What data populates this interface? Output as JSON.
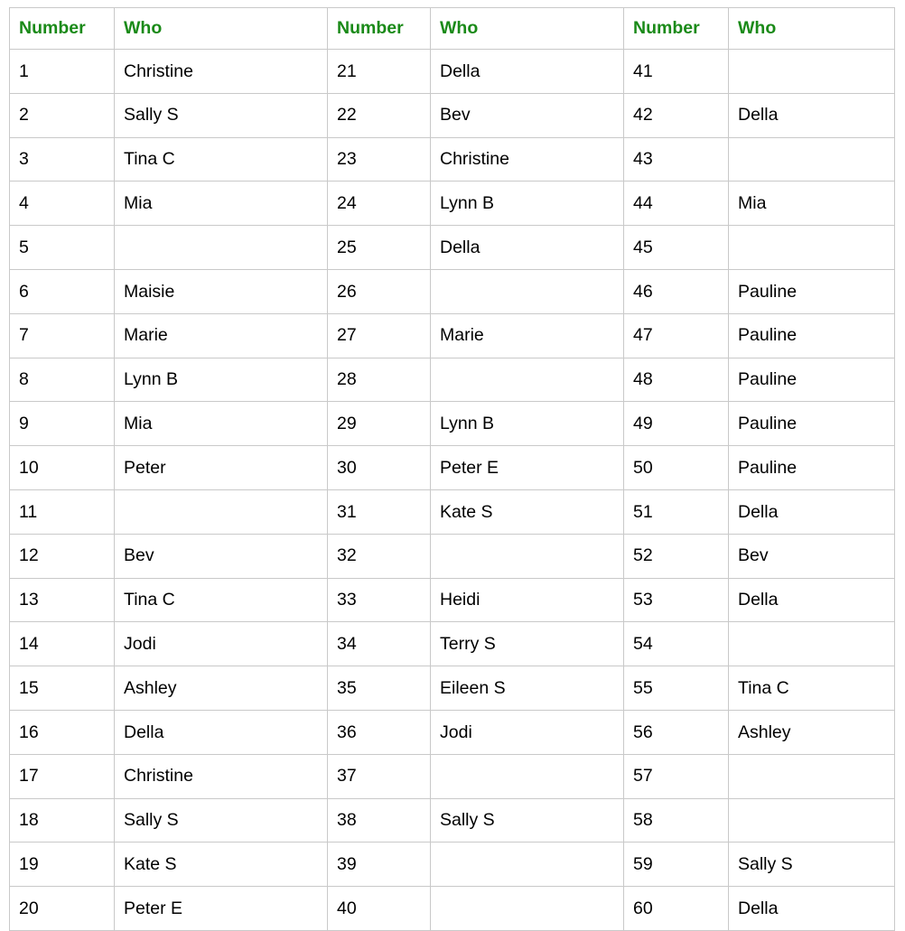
{
  "table": {
    "accent_color": "#1a8a18",
    "border_color": "#c9c9c9",
    "text_color": "#000000",
    "background": "#ffffff",
    "headers": [
      "Number",
      "Who",
      "Number",
      "Who",
      "Number",
      "Who"
    ],
    "rows": [
      [
        "1",
        "Christine",
        "21",
        "Della",
        "41",
        ""
      ],
      [
        "2",
        "Sally S",
        "22",
        "Bev",
        "42",
        "Della"
      ],
      [
        "3",
        "Tina C",
        "23",
        "Christine",
        "43",
        ""
      ],
      [
        "4",
        "Mia",
        "24",
        "Lynn B",
        "44",
        "Mia"
      ],
      [
        "5",
        "",
        "25",
        "Della",
        "45",
        ""
      ],
      [
        "6",
        "Maisie",
        "26",
        "",
        "46",
        "Pauline"
      ],
      [
        "7",
        "Marie",
        "27",
        "Marie",
        "47",
        "Pauline"
      ],
      [
        "8",
        "Lynn B",
        "28",
        "",
        "48",
        "Pauline"
      ],
      [
        "9",
        "Mia",
        "29",
        "Lynn B",
        "49",
        "Pauline"
      ],
      [
        "10",
        "Peter",
        "30",
        "Peter E",
        "50",
        "Pauline"
      ],
      [
        "11",
        "",
        "31",
        "Kate S",
        "51",
        "Della"
      ],
      [
        "12",
        "Bev",
        "32",
        "",
        "52",
        "Bev"
      ],
      [
        "13",
        "Tina C",
        "33",
        "Heidi",
        "53",
        "Della"
      ],
      [
        "14",
        "Jodi",
        "34",
        "Terry S",
        "54",
        ""
      ],
      [
        "15",
        "Ashley",
        "35",
        "Eileen S",
        "55",
        "Tina C"
      ],
      [
        "16",
        "Della",
        "36",
        "Jodi",
        "56",
        "Ashley"
      ],
      [
        "17",
        "Christine",
        "37",
        "",
        "57",
        ""
      ],
      [
        "18",
        "Sally S",
        "38",
        "Sally S",
        "58",
        ""
      ],
      [
        "19",
        "Kate S",
        "39",
        "",
        "59",
        "Sally S"
      ],
      [
        "20",
        "Peter E",
        "40",
        "",
        "60",
        "Della"
      ]
    ]
  }
}
